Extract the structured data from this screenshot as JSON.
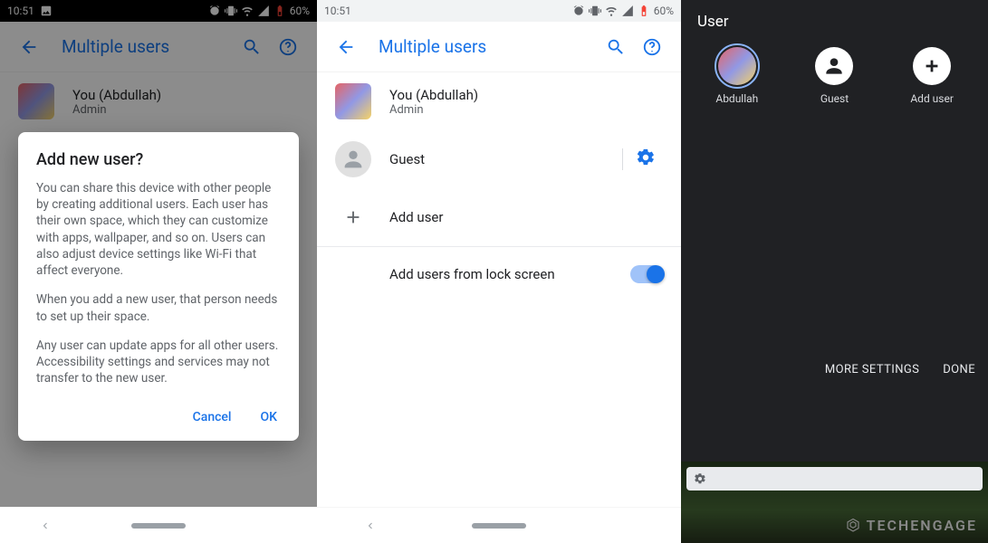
{
  "status": {
    "time": "10:51",
    "battery_pct": "60%"
  },
  "appbar": {
    "title": "Multiple users"
  },
  "users": {
    "owner_name": "You (Abdullah)",
    "owner_role": "Admin",
    "guest_label": "Guest",
    "add_label": "Add user",
    "lockscreen_label": "Add users from lock screen"
  },
  "dialog": {
    "title": "Add new user?",
    "p1": "You can share this device with other people by creating additional users. Each user has their own space, which they can customize with apps, wallpaper, and so on. Users can also adjust device settings like Wi-Fi that affect everyone.",
    "p2": "When you add a new user, that person needs to set up their space.",
    "p3": "Any user can update apps for all other users. Accessibility settings and services may not transfer to the new user.",
    "cancel": "Cancel",
    "ok": "OK"
  },
  "quick": {
    "title": "User",
    "u1": "Abdullah",
    "u2": "Guest",
    "u3": "Add user",
    "more": "MORE SETTINGS",
    "done": "DONE"
  },
  "brand": "TECHENGAGE"
}
